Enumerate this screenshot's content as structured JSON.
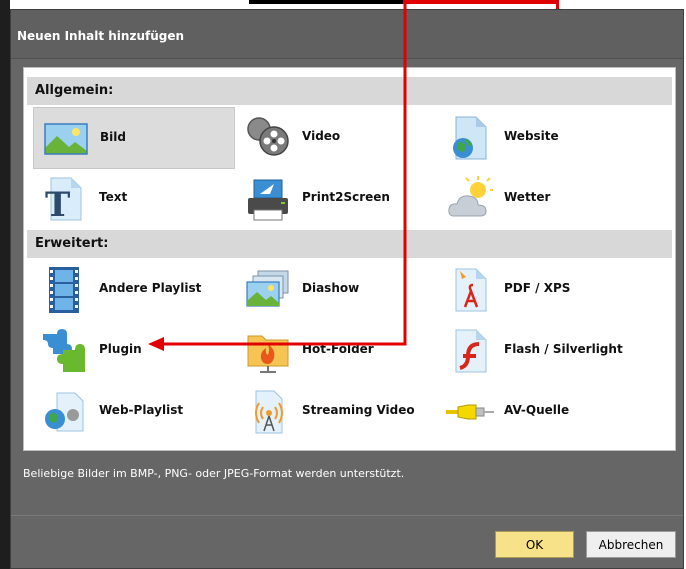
{
  "dialog": {
    "title": "Neuen Inhalt hinzufügen",
    "status_text": "Beliebige Bilder im BMP-, PNG- oder JPEG-Format werden unterstützt.",
    "ok_label": "OK",
    "cancel_label": "Abbrechen"
  },
  "sections": {
    "general": {
      "label": "Allgemein:",
      "items": [
        {
          "label": "Bild",
          "icon": "image-icon"
        },
        {
          "label": "Video",
          "icon": "film-reel-icon"
        },
        {
          "label": "Website",
          "icon": "web-page-icon"
        },
        {
          "label": "Text",
          "icon": "text-icon"
        },
        {
          "label": "Print2Screen",
          "icon": "printer-icon"
        },
        {
          "label": "Wetter",
          "icon": "weather-icon"
        }
      ]
    },
    "advanced": {
      "label": "Erweitert:",
      "items": [
        {
          "label": "Andere Playlist",
          "icon": "filmstrip-icon"
        },
        {
          "label": "Diashow",
          "icon": "slideshow-icon"
        },
        {
          "label": "PDF / XPS",
          "icon": "pdf-icon"
        },
        {
          "label": "Plugin",
          "icon": "puzzle-icon"
        },
        {
          "label": "Hot-Folder",
          "icon": "hot-folder-icon"
        },
        {
          "label": "Flash / Silverlight",
          "icon": "flash-icon"
        },
        {
          "label": "Web-Playlist",
          "icon": "web-playlist-icon"
        },
        {
          "label": "Streaming Video",
          "icon": "streaming-icon"
        },
        {
          "label": "AV-Quelle",
          "icon": "av-cable-icon"
        }
      ]
    }
  },
  "colors": {
    "dialog_bg": "#666666",
    "section_header_bg": "#d8d8d8",
    "selected_tile_bg": "#dcdcdc",
    "ok_button_bg": "#f7e28a",
    "annotation_arrow": "#e00000"
  }
}
